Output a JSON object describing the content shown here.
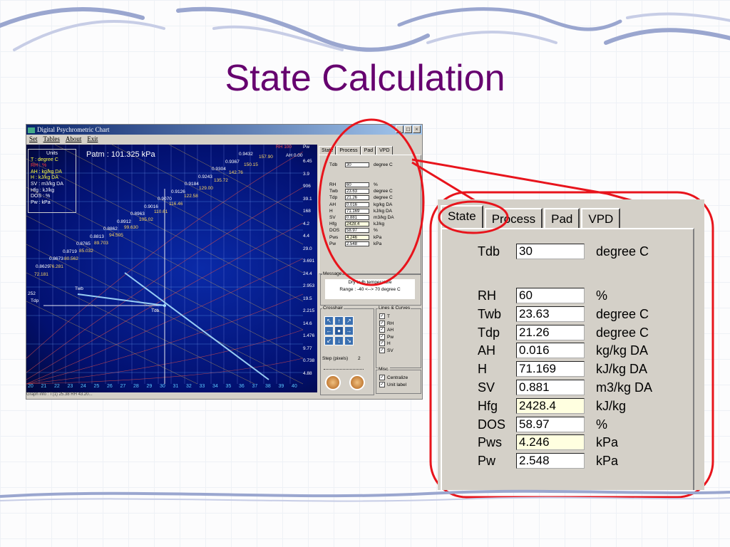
{
  "slide": {
    "title": "State Calculation"
  },
  "window": {
    "title": "Digital Psychrometric Chart",
    "buttons": [
      "_",
      "□",
      "×"
    ],
    "menu": [
      "Set",
      "Tables",
      "About",
      "Exit"
    ]
  },
  "chart": {
    "patm": "Patm : 101.325  kPa",
    "units_title": "Units",
    "units": [
      {
        "text": "T     : degree C",
        "color": "#ffff40"
      },
      {
        "text": "RH   : %",
        "color": "#ff4040"
      },
      {
        "text": "AH  : kg/kg DA",
        "color": "#ffff40"
      },
      {
        "text": "H    : kJ/kg DA",
        "color": "#ffff40"
      },
      {
        "text": "SV  : m3/kg DA",
        "color": "#ffffff"
      },
      {
        "text": "Hfg  : kJ/kg",
        "color": "#ffffff"
      },
      {
        "text": "DOS  : %",
        "color": "#ffffff"
      },
      {
        "text": "Pw  : kPa",
        "color": "#ffffff"
      }
    ],
    "sv_labels": [
      "0.9432",
      "0.9367",
      "0.9304",
      "0.9243",
      "0.9184",
      "0.9126",
      "0.9070",
      "0.9016",
      "0.8963",
      "0.8912",
      "0.8862",
      "0.8813",
      "0.8765",
      "0.8719",
      "0.8673",
      "0.8629"
    ],
    "h_labels": [
      "157.90",
      "150.15",
      "142.76",
      "135.72",
      "129.00",
      "122.58",
      "116.46",
      "110.61",
      "105.02",
      "99.630",
      "94.505",
      "89.703",
      "85.032",
      "80.562",
      "76.281",
      "72.181"
    ],
    "right_labels": [
      "RH 100",
      "AH 0.00",
      "Pw",
      "6.45",
      "3.9",
      "906",
      "39.1",
      "168",
      "4.2",
      "4.4",
      "29.0",
      "3.691",
      "24.4",
      "2.953",
      "19.5",
      "2.215",
      "14.6",
      "1.476",
      "9.77",
      "0.738",
      "4.88"
    ],
    "x_ticks": [
      "20",
      "21",
      "22",
      "23",
      "24",
      "25",
      "26",
      "27",
      "28",
      "29",
      "30",
      "31",
      "32",
      "33",
      "34",
      "35",
      "36",
      "37",
      "38",
      "39",
      "40"
    ],
    "point_labels": {
      "twb": "Twb",
      "tdp": "Tdp",
      "tdb": "Tdb",
      "left_edge": "252"
    },
    "status": "Graph info : T(1)  25.38  RH 43.20..."
  },
  "state_panel": {
    "tabs": [
      "State",
      "Process",
      "Pad",
      "VPD"
    ],
    "rows": [
      {
        "label": "Tdb",
        "value": "30",
        "unit": "degree C",
        "editable": true
      },
      {
        "label": "RH",
        "value": "60",
        "unit": "%",
        "editable": true
      },
      {
        "label": "Twb",
        "value": "23.63",
        "unit": "degree C",
        "editable": true
      },
      {
        "label": "Tdp",
        "value": "21.26",
        "unit": "degree C",
        "editable": true
      },
      {
        "label": "AH",
        "value": "0.016",
        "unit": "kg/kg DA",
        "editable": true
      },
      {
        "label": "H",
        "value": "71.169",
        "unit": "kJ/kg DA",
        "editable": true
      },
      {
        "label": "SV",
        "value": "0.881",
        "unit": "m3/kg DA",
        "editable": true
      },
      {
        "label": "Hfg",
        "value": "2428.4",
        "unit": "kJ/kg",
        "editable": false
      },
      {
        "label": "DOS",
        "value": "58.97",
        "unit": "%",
        "editable": true
      },
      {
        "label": "Pws",
        "value": "4.246",
        "unit": "kPa",
        "editable": false
      },
      {
        "label": "Pw",
        "value": "2.548",
        "unit": "kPa",
        "editable": true
      }
    ]
  },
  "message": {
    "title": "Message",
    "line1": "Dry bulb temperature",
    "line2": "Range : -40  <--> 70 degree C"
  },
  "crosshair": {
    "title": "Crosshair",
    "step_label": "Step (pixels)",
    "step_value": "2"
  },
  "lines_curves": {
    "title": "Lines & Curves",
    "items": [
      "T",
      "RH",
      "AH",
      "Pw",
      "H",
      "SV"
    ]
  },
  "misc": {
    "title": "Misc.",
    "items": [
      "Centralize",
      "Unit label"
    ]
  }
}
